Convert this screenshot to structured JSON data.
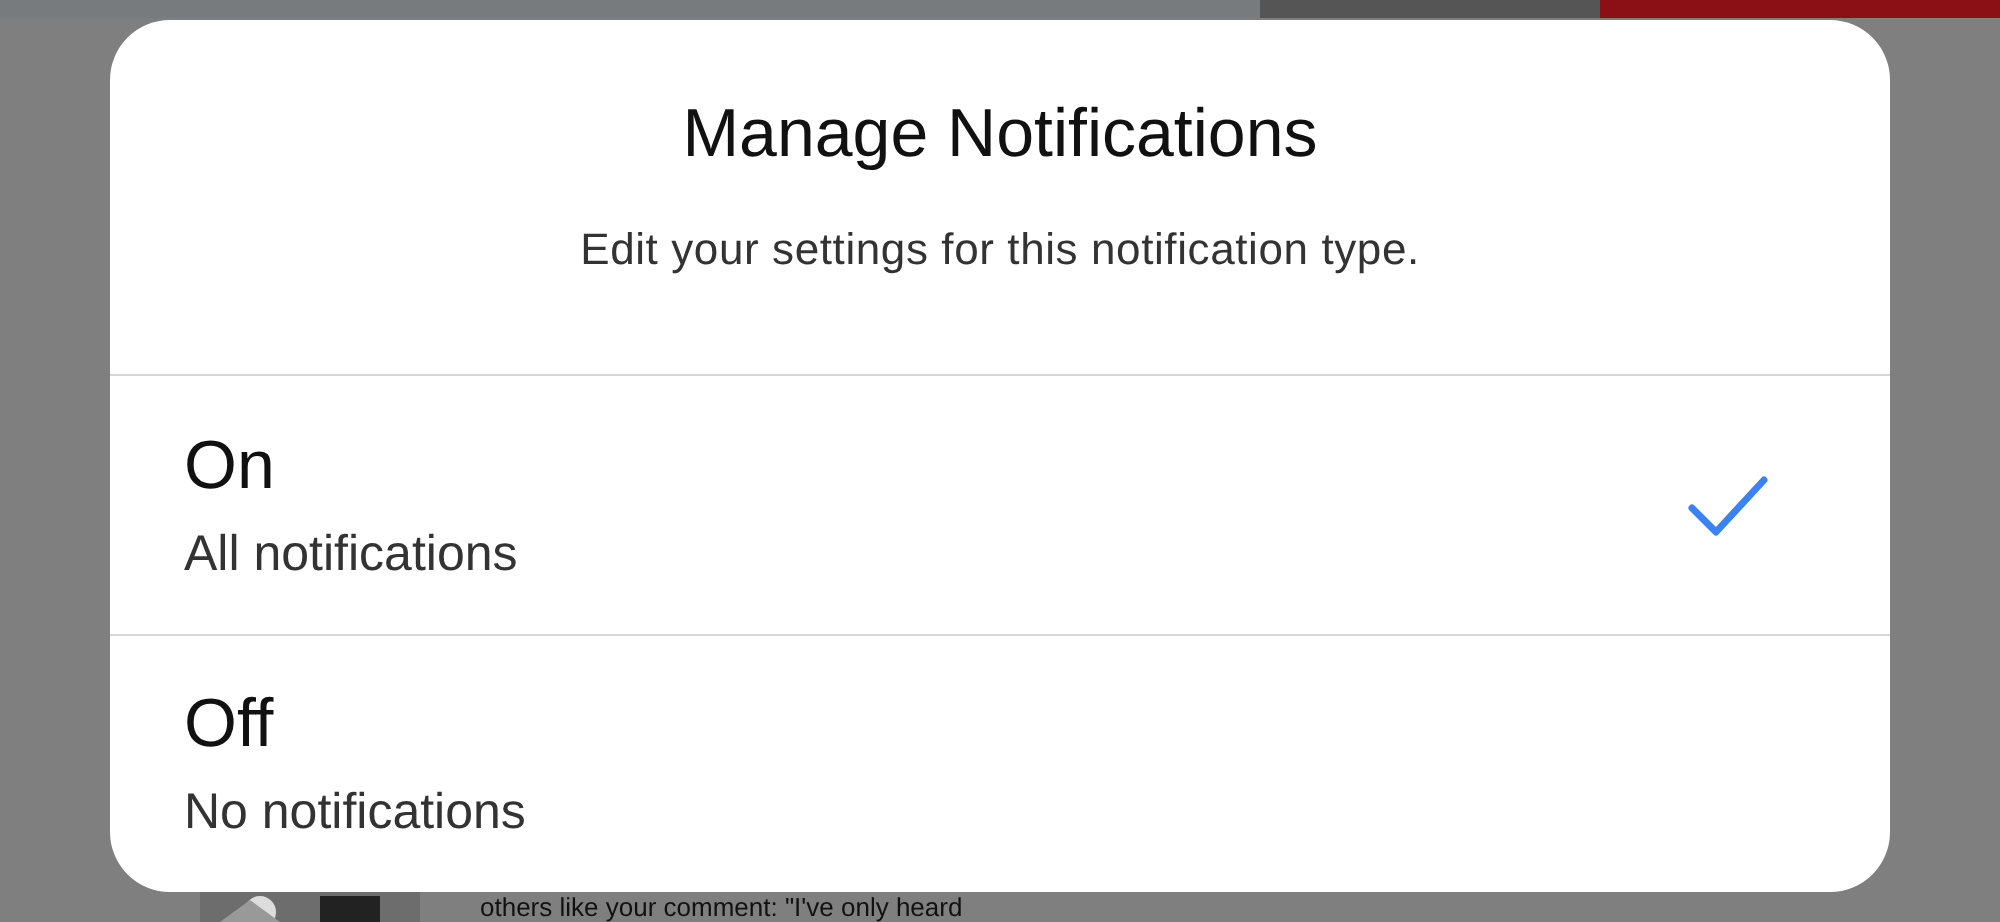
{
  "dialog": {
    "title": "Manage Notifications",
    "subtitle": "Edit your settings for this notification type.",
    "options": [
      {
        "label": "On",
        "description": "All notifications",
        "selected": true
      },
      {
        "label": "Off",
        "description": "No notifications",
        "selected": false
      }
    ]
  },
  "background": {
    "comment_snippet": "others like your comment: \"I've only heard"
  }
}
